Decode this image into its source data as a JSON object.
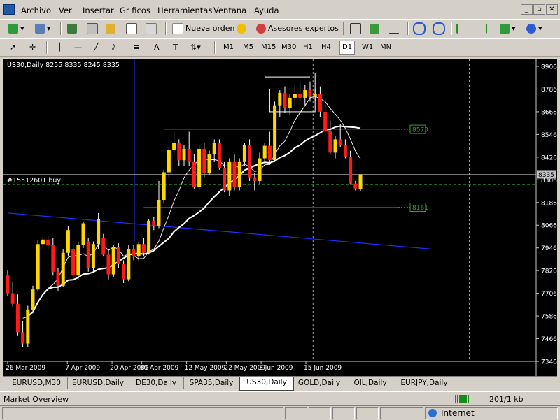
{
  "menu": [
    "Archivo",
    "Ver",
    "Insertar",
    "Gr ficos",
    "Herramientas",
    "Ventana",
    "Ayuda"
  ],
  "toolbar": {
    "new_order": "Nueva orden",
    "expert_advisors": "Asesores expertos"
  },
  "timeframes": [
    "M1",
    "M5",
    "M15",
    "M30",
    "H1",
    "H4",
    "D1",
    "W1",
    "MN"
  ],
  "active_timeframe": "D1",
  "chart_data": {
    "type": "candlestick",
    "title": "US30,Daily  8255 8335 8245 8335",
    "symbol": "US30",
    "period": "Daily",
    "last_ohlc": {
      "open": 8255,
      "high": 8335,
      "low": 8245,
      "close": 8335
    },
    "ylim": [
      7346,
      8906
    ],
    "y_ticks": [
      8906,
      8786,
      8666,
      8546,
      8426,
      8306,
      8186,
      8066,
      7946,
      7826,
      7706,
      7586,
      7466,
      7346
    ],
    "x_tick_labels": [
      "26 Mar 2009",
      "7 Apr 2009",
      "20 Apr 2009",
      "30 Apr 2009",
      "12 May 2009",
      "22 May 2009",
      "3 Jun 2009",
      "15 Jun 2009"
    ],
    "bull_color": "#ffd700",
    "bear_color": "#ff1a1a",
    "current_price": {
      "value": 8335,
      "label": "8335"
    },
    "order_line": {
      "label": "#15512601 buy",
      "value": 8281
    },
    "price_alerts": [
      {
        "label": "8573",
        "value": 8573
      },
      {
        "label": "8161",
        "value": 8161
      }
    ],
    "candles": [
      [
        7800,
        7826,
        7690,
        7706
      ],
      [
        7706,
        7766,
        7630,
        7650
      ],
      [
        7650,
        7700,
        7480,
        7500
      ],
      [
        7500,
        7560,
        7420,
        7440
      ],
      [
        7440,
        7640,
        7420,
        7620
      ],
      [
        7620,
        7746,
        7600,
        7726
      ],
      [
        7726,
        7986,
        7720,
        7966
      ],
      [
        7966,
        8010,
        7940,
        7990
      ],
      [
        7990,
        8010,
        7940,
        7960
      ],
      [
        7960,
        8000,
        7800,
        7820
      ],
      [
        7820,
        7840,
        7720,
        7746
      ],
      [
        7746,
        7940,
        7740,
        7920
      ],
      [
        7920,
        8060,
        7900,
        8040
      ],
      [
        7940,
        7960,
        7780,
        7800
      ],
      [
        7800,
        7980,
        7780,
        7960
      ],
      [
        7960,
        8086,
        7945,
        8076
      ],
      [
        7980,
        8000,
        7820,
        7840
      ],
      [
        7840,
        7980,
        7820,
        7966
      ],
      [
        7966,
        8130,
        7940,
        8100
      ],
      [
        8000,
        8020,
        7900,
        7910
      ],
      [
        7910,
        7940,
        7780,
        7806
      ],
      [
        7806,
        7960,
        7790,
        7950
      ],
      [
        7950,
        7970,
        7840,
        7860
      ],
      [
        7860,
        7880,
        7760,
        7780
      ],
      [
        7780,
        7960,
        7770,
        7940
      ],
      [
        7940,
        7960,
        7880,
        7900
      ],
      [
        7900,
        7980,
        7880,
        7966
      ],
      [
        7966,
        8000,
        7900,
        7920
      ],
      [
        7920,
        8100,
        7910,
        8090
      ],
      [
        8090,
        8110,
        8040,
        8060
      ],
      [
        8060,
        8300,
        8050,
        8200
      ],
      [
        8200,
        8360,
        8180,
        8346
      ],
      [
        8346,
        8480,
        8320,
        8466
      ],
      [
        8466,
        8560,
        8440,
        8500
      ],
      [
        8500,
        8520,
        8380,
        8410
      ],
      [
        8410,
        8490,
        8380,
        8470
      ],
      [
        8470,
        8560,
        8380,
        8400
      ],
      [
        8400,
        8440,
        8260,
        8270
      ],
      [
        8270,
        8490,
        8250,
        8470
      ],
      [
        8470,
        8500,
        8320,
        8340
      ],
      [
        8340,
        8460,
        8330,
        8440
      ],
      [
        8440,
        8520,
        8400,
        8500
      ],
      [
        8500,
        8520,
        8360,
        8370
      ],
      [
        8370,
        8400,
        8240,
        8250
      ],
      [
        8250,
        8420,
        8220,
        8400
      ],
      [
        8400,
        8440,
        8250,
        8270
      ],
      [
        8270,
        8420,
        8250,
        8400
      ],
      [
        8400,
        8500,
        8380,
        8490
      ],
      [
        8490,
        8520,
        8300,
        8320
      ],
      [
        8320,
        8340,
        8250,
        8300
      ],
      [
        8300,
        8450,
        8280,
        8420
      ],
      [
        8420,
        8500,
        8400,
        8486
      ],
      [
        8486,
        8560,
        8400,
        8410
      ],
      [
        8410,
        8720,
        8400,
        8700
      ],
      [
        8700,
        8780,
        8640,
        8766
      ],
      [
        8766,
        8800,
        8660,
        8686
      ],
      [
        8686,
        8760,
        8650,
        8740
      ],
      [
        8740,
        8806,
        8700,
        8760
      ],
      [
        8760,
        8820,
        8720,
        8740
      ],
      [
        8740,
        8810,
        8700,
        8780
      ],
      [
        8780,
        8826,
        8720,
        8746
      ],
      [
        8746,
        8870,
        8720,
        8760
      ],
      [
        8760,
        8800,
        8640,
        8666
      ],
      [
        8666,
        8740,
        8560,
        8566
      ],
      [
        8566,
        8620,
        8440,
        8450
      ],
      [
        8450,
        8540,
        8420,
        8520
      ],
      [
        8520,
        8600,
        8480,
        8490
      ],
      [
        8490,
        8520,
        8420,
        8430
      ],
      [
        8430,
        8460,
        8280,
        8286
      ],
      [
        8286,
        8300,
        8250,
        8260
      ],
      [
        8255,
        8335,
        8245,
        8335
      ]
    ]
  },
  "tabs": [
    "EURUSD,M30",
    "EURUSD,Daily",
    "DE30,Daily",
    "SPA35,Daily",
    "US30,Daily",
    "GOLD,Daily",
    "OIL,Daily",
    "EURJPY,Daily"
  ],
  "active_tab": "US30,Daily",
  "status": {
    "left": "Market Overview",
    "traffic": "201/1 kb"
  },
  "ie": {
    "zone": "Internet"
  }
}
